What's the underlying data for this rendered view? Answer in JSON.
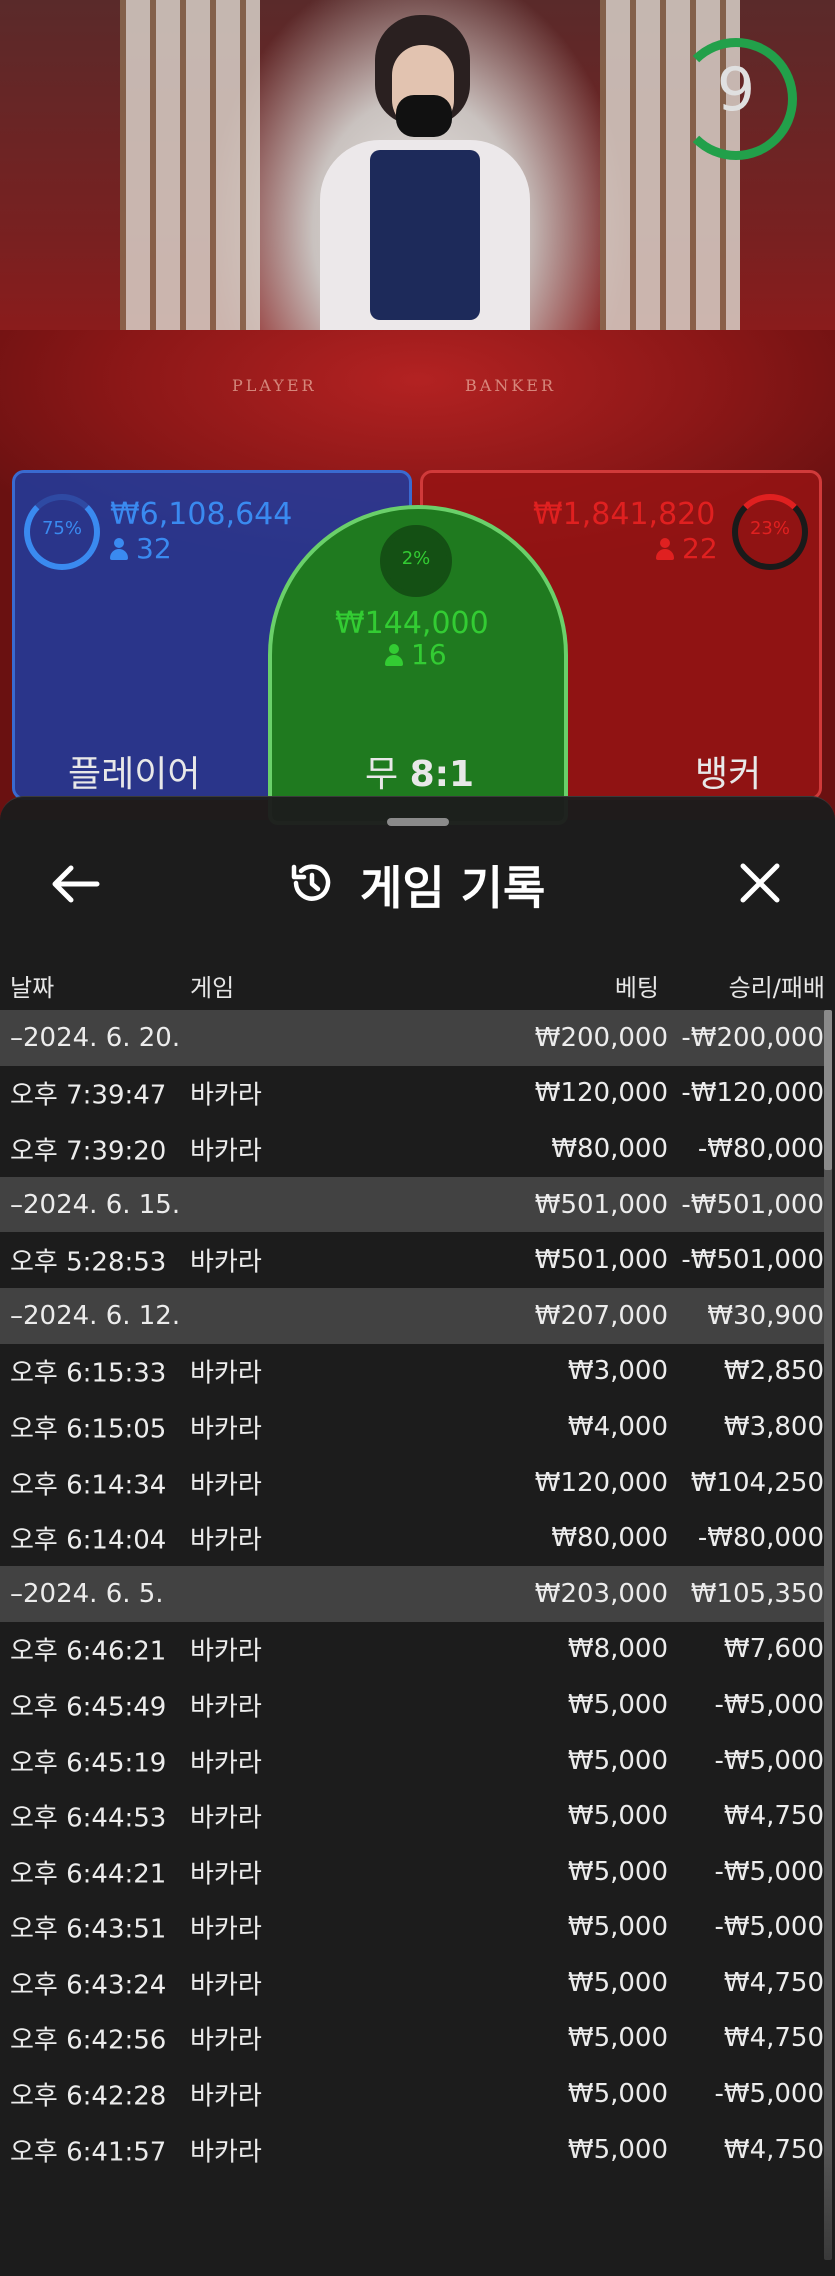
{
  "game": {
    "timer": "9",
    "felt_player": "PLAYER",
    "felt_banker": "BANKER",
    "player": {
      "percent": "75%",
      "amount": "₩6,108,644",
      "count": "32",
      "label": "플레이어"
    },
    "tie": {
      "percent": "2%",
      "amount": "₩144,000",
      "count": "16",
      "label_prefix": "무",
      "label_odds": "8:1"
    },
    "banker": {
      "percent": "23%",
      "amount": "₩1,841,820",
      "count": "22",
      "label": "뱅커"
    }
  },
  "sheet": {
    "title": "게임 기록",
    "columns": {
      "date": "날짜",
      "game": "게임",
      "bet": "베팅",
      "result": "승리/패배"
    },
    "rows": [
      {
        "type": "group",
        "time": "–2024. 6. 20.",
        "game": "",
        "bet": "₩200,000",
        "result": "-₩200,000"
      },
      {
        "type": "item",
        "time": "오후 7:39:47",
        "game": "바카라",
        "bet": "₩120,000",
        "result": "-₩120,000"
      },
      {
        "type": "item",
        "time": "오후 7:39:20",
        "game": "바카라",
        "bet": "₩80,000",
        "result": "-₩80,000"
      },
      {
        "type": "group",
        "time": "–2024. 6. 15.",
        "game": "",
        "bet": "₩501,000",
        "result": "-₩501,000"
      },
      {
        "type": "item",
        "time": "오후 5:28:53",
        "game": "바카라",
        "bet": "₩501,000",
        "result": "-₩501,000"
      },
      {
        "type": "group",
        "time": "–2024. 6. 12.",
        "game": "",
        "bet": "₩207,000",
        "result": "₩30,900"
      },
      {
        "type": "item",
        "time": "오후 6:15:33",
        "game": "바카라",
        "bet": "₩3,000",
        "result": "₩2,850"
      },
      {
        "type": "item",
        "time": "오후 6:15:05",
        "game": "바카라",
        "bet": "₩4,000",
        "result": "₩3,800"
      },
      {
        "type": "item",
        "time": "오후 6:14:34",
        "game": "바카라",
        "bet": "₩120,000",
        "result": "₩104,250"
      },
      {
        "type": "item",
        "time": "오후 6:14:04",
        "game": "바카라",
        "bet": "₩80,000",
        "result": "-₩80,000"
      },
      {
        "type": "group",
        "time": "–2024. 6. 5.",
        "game": "",
        "bet": "₩203,000",
        "result": "₩105,350"
      },
      {
        "type": "item",
        "time": "오후 6:46:21",
        "game": "바카라",
        "bet": "₩8,000",
        "result": "₩7,600"
      },
      {
        "type": "item",
        "time": "오후 6:45:49",
        "game": "바카라",
        "bet": "₩5,000",
        "result": "-₩5,000"
      },
      {
        "type": "item",
        "time": "오후 6:45:19",
        "game": "바카라",
        "bet": "₩5,000",
        "result": "-₩5,000"
      },
      {
        "type": "item",
        "time": "오후 6:44:53",
        "game": "바카라",
        "bet": "₩5,000",
        "result": "₩4,750"
      },
      {
        "type": "item",
        "time": "오후 6:44:21",
        "game": "바카라",
        "bet": "₩5,000",
        "result": "-₩5,000"
      },
      {
        "type": "item",
        "time": "오후 6:43:51",
        "game": "바카라",
        "bet": "₩5,000",
        "result": "-₩5,000"
      },
      {
        "type": "item",
        "time": "오후 6:43:24",
        "game": "바카라",
        "bet": "₩5,000",
        "result": "₩4,750"
      },
      {
        "type": "item",
        "time": "오후 6:42:56",
        "game": "바카라",
        "bet": "₩5,000",
        "result": "₩4,750"
      },
      {
        "type": "item",
        "time": "오후 6:42:28",
        "game": "바카라",
        "bet": "₩5,000",
        "result": "-₩5,000"
      },
      {
        "type": "item",
        "time": "오후 6:41:57",
        "game": "바카라",
        "bet": "₩5,000",
        "result": "₩4,750"
      }
    ]
  },
  "colors": {
    "player": "#3a8af0",
    "banker": "#e02020",
    "tie": "#33cc33",
    "timer": "#22a04a"
  },
  "icons": {
    "back": "arrow-left-icon",
    "history": "history-icon",
    "close": "close-icon",
    "person": "person-icon"
  }
}
